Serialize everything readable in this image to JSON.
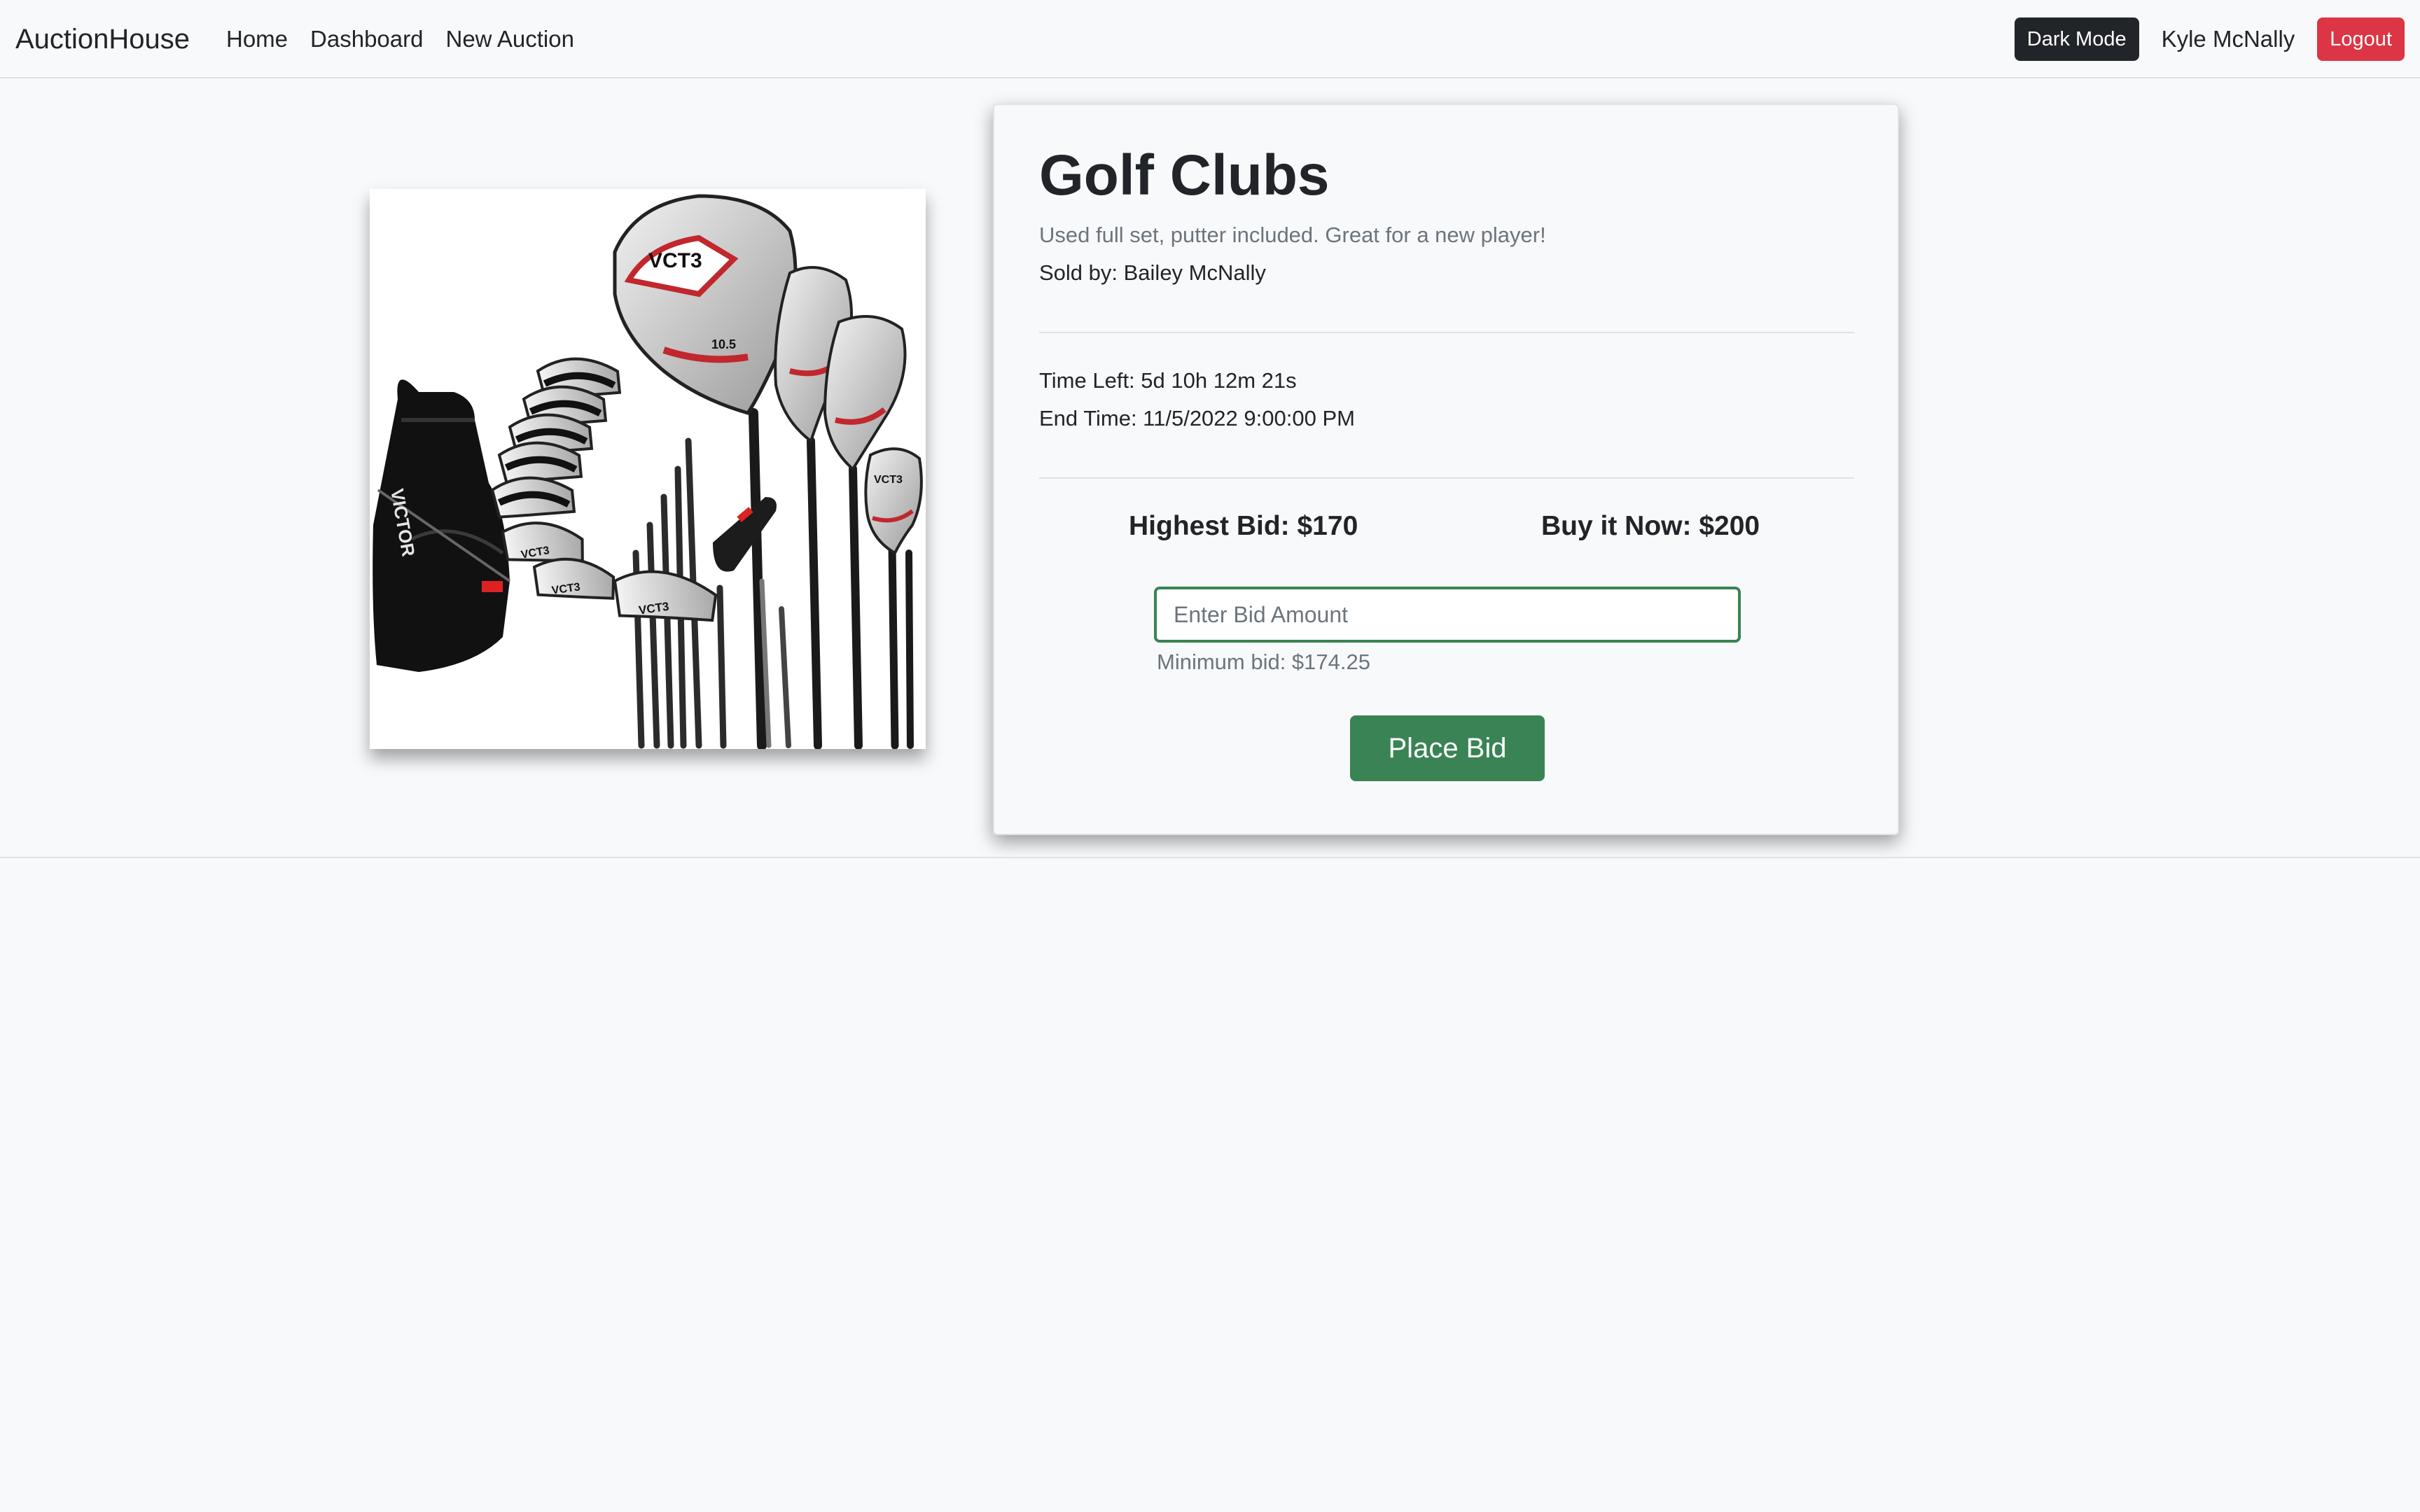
{
  "navbar": {
    "brand": "AuctionHouse",
    "links": [
      "Home",
      "Dashboard",
      "New Auction"
    ],
    "dark_mode_label": "Dark Mode",
    "user_name": "Kyle McNally",
    "logout_label": "Logout"
  },
  "auction": {
    "title": "Golf Clubs",
    "description": "Used full set, putter included. Great for a new player!",
    "seller": "Sold by: Bailey McNally",
    "time_left": "Time Left: 5d 10h 12m 21s",
    "end_time": "End Time: 11/5/2022 9:00:00 PM",
    "highest_bid": "Highest Bid: $170",
    "buy_now": "Buy it Now: $200",
    "bid_input_value": "",
    "bid_placeholder": "Enter Bid Amount",
    "min_bid": "Minimum bid: $174.25",
    "place_bid_label": "Place Bid",
    "image_lettering": [
      "VCT3",
      "VCT3",
      "VCT3",
      "VCT3",
      "VICTOR",
      "10.5"
    ]
  },
  "colors": {
    "background": "#f8f9fa",
    "accent_green": "#3a8354",
    "danger": "#dc3545",
    "dark": "#212529",
    "muted": "#6c757d"
  },
  "icons": [
    "golf-bag-icon",
    "driver-icon",
    "fairway-wood-icon",
    "iron-icon",
    "putter-icon"
  ]
}
